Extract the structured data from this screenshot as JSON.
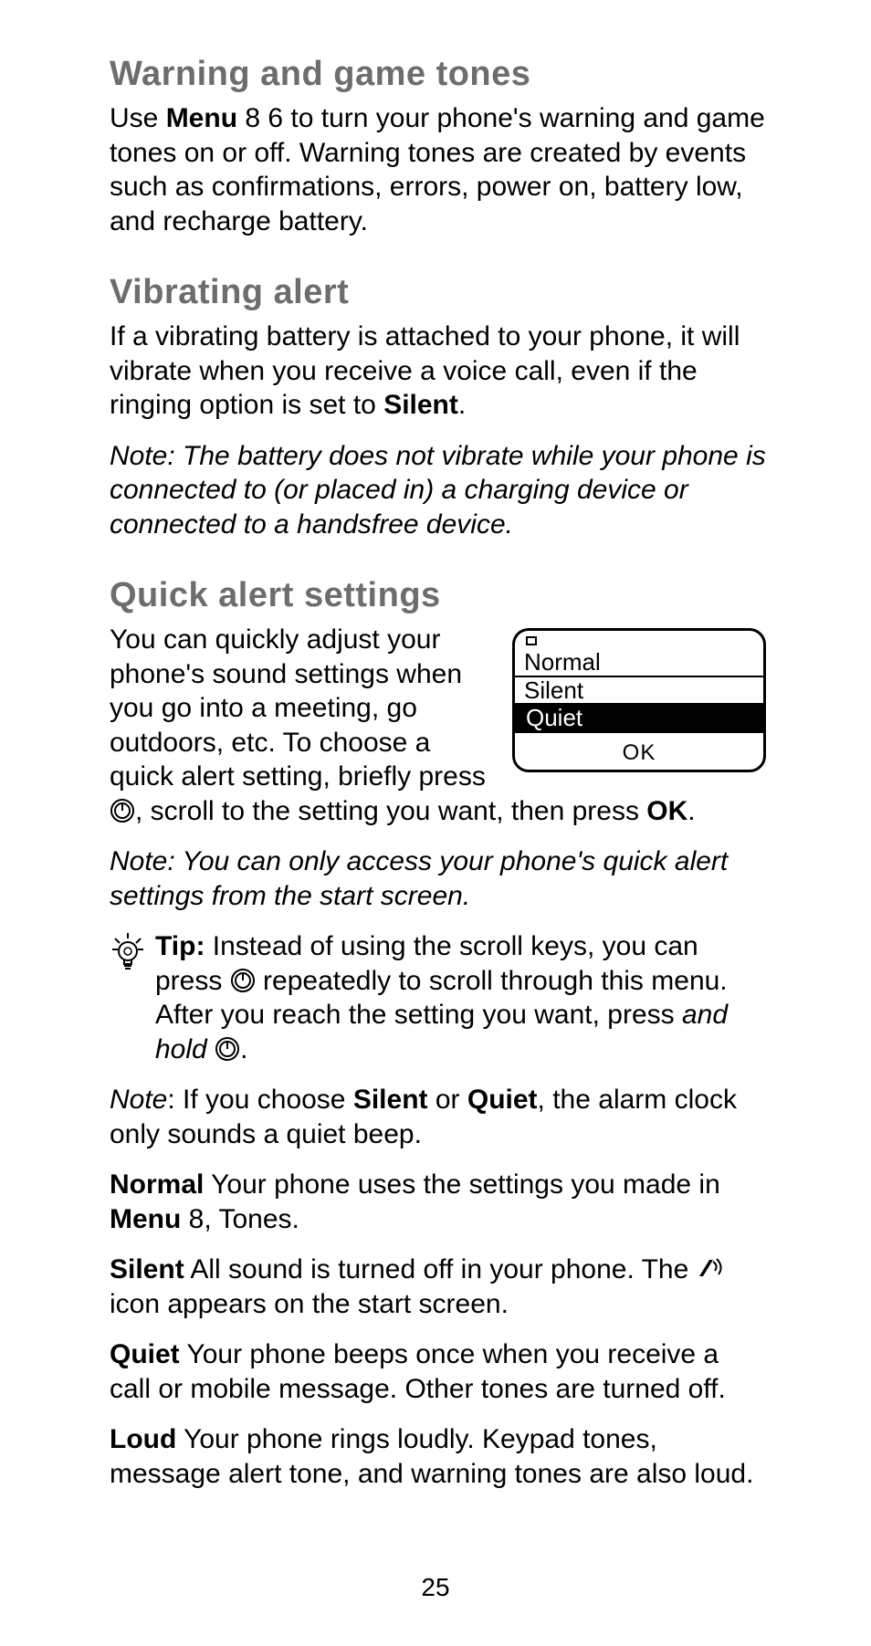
{
  "sections": {
    "warning": {
      "heading": "Warning and game tones",
      "body_pre": "Use ",
      "menu_bold": "Menu",
      "body_post": " 8 6 to turn your phone's warning and game tones on or off. Warning tones are created by events such as confirmations, errors, power on, battery low, and recharge battery."
    },
    "vibrating": {
      "heading": "Vibrating alert",
      "body_pre": "If a vibrating battery is attached to your phone, it will vibrate when you receive a voice call, even if the ringing option is set to ",
      "silent_bold": "Silent",
      "body_post": ".",
      "note": "Note:  The battery does not vibrate while your phone is connected to (or placed in) a charging device or connected to a handsfree device."
    },
    "quick": {
      "heading": "Quick alert settings",
      "body_pre": "You can quickly adjust your phone's sound settings when you go into a meeting, go outdoors, etc. To choose a quick alert setting, briefly press ",
      "body_mid": ", scroll to the setting you want, then press ",
      "ok_bold": "OK",
      "body_post": ".",
      "note_start": "Note: You can only access your phone's quick alert settings from the start screen.",
      "tip_label": "Tip:  ",
      "tip_pre": "Instead of using the scroll keys, you can press ",
      "tip_mid": " repeatedly to scroll through this menu. After you reach the setting you want, press ",
      "tip_hold_italic": "and hold ",
      "tip_post": ".",
      "note2_pre_italic": "Note",
      "note2_pre": ": If you choose ",
      "note2_silent": "Silent",
      "note2_or": " or ",
      "note2_quiet": "Quiet",
      "note2_post": ", the alarm clock only sounds a quiet beep.",
      "modes": {
        "normal_label": "Normal",
        "normal_pre": "  Your phone uses the settings you made in ",
        "normal_menu": "Menu",
        "normal_post": " 8, Tones.",
        "silent_label": "Silent",
        "silent_pre": "  All sound is turned off in your phone. The  ",
        "silent_post": "  icon appears on the start screen.",
        "quiet_label": "Quiet",
        "quiet_body": "  Your phone beeps once when you receive a call or mobile message. Other tones are turned off.",
        "loud_label": "Loud",
        "loud_body": "  Your phone rings loudly. Keypad tones, message alert tone, and warning tones are also loud."
      }
    }
  },
  "phone_preview": {
    "items": [
      "Normal",
      "Silent",
      "Quiet"
    ],
    "selected_index": 2,
    "softkey": "OK"
  },
  "page_number": "25"
}
